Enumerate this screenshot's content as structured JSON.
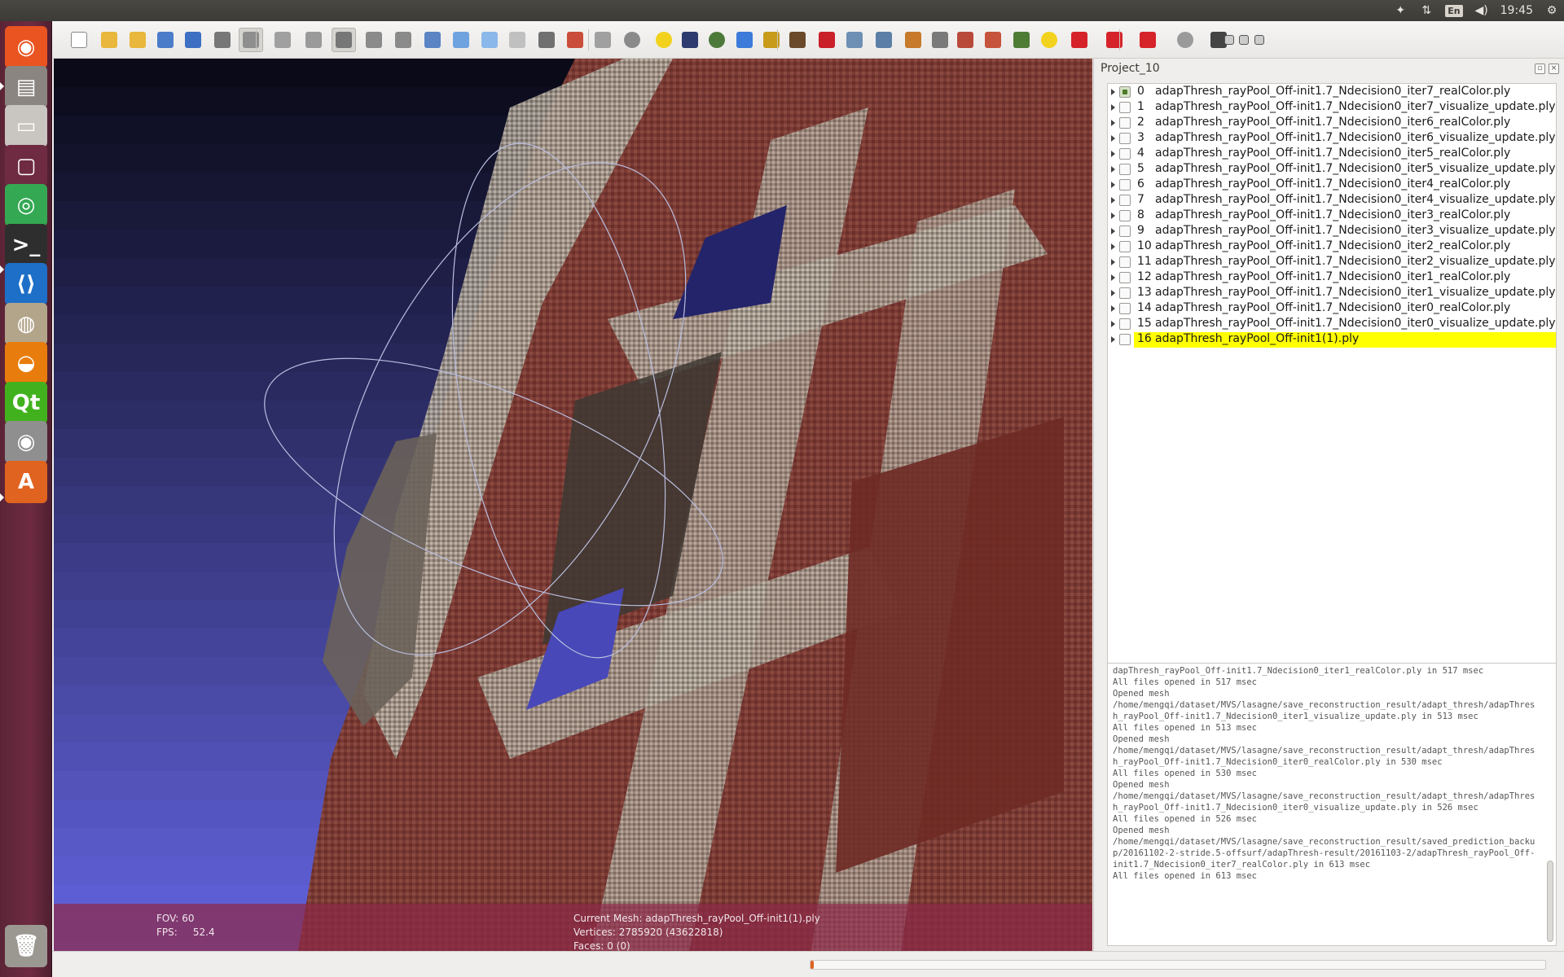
{
  "top_panel": {
    "lang": "En",
    "time": "19:45",
    "icons": [
      "dropbox-icon",
      "network-arrows-icon",
      "keyboard-lang-icon",
      "volume-icon",
      "settings-gear-icon"
    ]
  },
  "launcher": {
    "items": [
      {
        "name": "ubuntu-dash-icon",
        "glyph": "◉",
        "color": "#e95420"
      },
      {
        "name": "files-icon",
        "glyph": "▤",
        "color": "#8a8580"
      },
      {
        "name": "drive-icon",
        "glyph": "▭",
        "color": "#c9c5c0"
      },
      {
        "name": "window-icon",
        "glyph": "▢",
        "color": "#6e2b42"
      },
      {
        "name": "chrome-icon",
        "glyph": "◎",
        "color": "#34a853"
      },
      {
        "name": "terminal-icon",
        "glyph": ">_",
        "color": "#2e2e2e"
      },
      {
        "name": "vscode-icon",
        "glyph": "⟨⟩",
        "color": "#1e6fc7"
      },
      {
        "name": "screenshot-tool-icon",
        "glyph": "◍",
        "color": "#b3a58a"
      },
      {
        "name": "blender-icon",
        "glyph": "◒",
        "color": "#e87d0d"
      },
      {
        "name": "qt-creator-icon",
        "glyph": "Qt",
        "color": "#41b21e"
      },
      {
        "name": "eye-of-gnome-icon",
        "glyph": "◉",
        "color": "#8f8f8f"
      },
      {
        "name": "software-center-icon",
        "glyph": "A",
        "color": "#e0631f"
      },
      {
        "name": "trash-icon",
        "glyph": "🗑",
        "color": "#9b9892"
      }
    ]
  },
  "toolbar": {
    "buttons": [
      {
        "name": "new-project-icon",
        "color": "#ffffff"
      },
      {
        "name": "open-project-icon",
        "color": "#e8b73b"
      },
      {
        "name": "import-mesh-icon",
        "color": "#e8b73b"
      },
      {
        "name": "reload-icon",
        "color": "#4a7cc9"
      },
      {
        "name": "export-mesh-icon",
        "color": "#3d6fc2"
      },
      {
        "name": "snapshot-icon",
        "color": "#777777"
      },
      {
        "name": "layer-dialog-icon",
        "color": "#8e8e8e"
      },
      {
        "name": "global-settings-icon",
        "color": "#a0a0a0"
      },
      {
        "name": "render-bbox-icon",
        "color": "#9a9a9a"
      },
      {
        "name": "render-points-icon",
        "color": "#777777"
      },
      {
        "name": "render-wire-icon",
        "color": "#8a8a8a"
      },
      {
        "name": "render-hidden-lines-icon",
        "color": "#8a8a8a"
      },
      {
        "name": "render-flat-lines-icon",
        "color": "#5a84c4"
      },
      {
        "name": "render-flat-icon",
        "color": "#6fa3e0"
      },
      {
        "name": "render-smooth-icon",
        "color": "#8ab8ea"
      },
      {
        "name": "render-texture-icon",
        "color": "#c0c0c0"
      },
      {
        "name": "light-on-icon",
        "color": "#707070"
      },
      {
        "name": "backface-icon",
        "color": "#c94d3a"
      },
      {
        "name": "selection-faces-icon",
        "color": "#a0a0a0"
      },
      {
        "name": "trackball-icon",
        "color": "#8a8a8a"
      },
      {
        "name": "annotation-icon",
        "color": "#f2d21c"
      },
      {
        "name": "shader-icon",
        "color": "#2d3b6e"
      },
      {
        "name": "texture-sphere-icon",
        "color": "#4d7a3a"
      },
      {
        "name": "measure-axis-icon",
        "color": "#3c7bd9"
      },
      {
        "name": "paint-icon",
        "color": "#c89b1a"
      },
      {
        "name": "brush-icon",
        "color": "#6a4a2a"
      },
      {
        "name": "pdf-icon",
        "color": "#c9202a"
      },
      {
        "name": "pick-points-icon",
        "color": "#6d8fb3"
      },
      {
        "name": "align-icon",
        "color": "#5b7fa6"
      },
      {
        "name": "z-painting-icon",
        "color": "#c67a2a"
      },
      {
        "name": "select-vertices-icon",
        "color": "#7a7a7a"
      },
      {
        "name": "edit-faces-icon",
        "color": "#b94a3a"
      },
      {
        "name": "edit-quality-icon",
        "color": "#c6533b"
      },
      {
        "name": "raster-icon",
        "color": "#4f7c35"
      },
      {
        "name": "info-icon",
        "color": "#f2d21c"
      },
      {
        "name": "delete-vertices-icon",
        "color": "#d6232a"
      },
      {
        "name": "delete-faces-icon",
        "color": "#d6232a"
      },
      {
        "name": "delete-all-icon",
        "color": "#d6232a"
      },
      {
        "name": "search-icon",
        "color": "#9a9a9a"
      },
      {
        "name": "eye-icon",
        "color": "#444444"
      },
      {
        "name": "minimize-icon",
        "color": "#cccccc"
      },
      {
        "name": "restore-icon",
        "color": "#cccccc"
      },
      {
        "name": "close-icon",
        "color": "#cccccc"
      }
    ]
  },
  "viewport": {
    "fov_label": "FOV: 60",
    "fps_label": "FPS:     52.4",
    "current_mesh": "Current Mesh: adapThresh_rayPool_Off-init1(1).ply",
    "vertices": "Vertices: 2785920 (43622818)",
    "faces": "Faces: 0 (0)"
  },
  "project": {
    "title": "Project_10",
    "layers": [
      {
        "index": "0",
        "name": "adapThresh_rayPool_Off-init1.7_Ndecision0_iter7_realColor.ply",
        "visible": true
      },
      {
        "index": "1",
        "name": "adapThresh_rayPool_Off-init1.7_Ndecision0_iter7_visualize_update.ply",
        "visible": false
      },
      {
        "index": "2",
        "name": "adapThresh_rayPool_Off-init1.7_Ndecision0_iter6_realColor.ply",
        "visible": false
      },
      {
        "index": "3",
        "name": "adapThresh_rayPool_Off-init1.7_Ndecision0_iter6_visualize_update.ply",
        "visible": false
      },
      {
        "index": "4",
        "name": "adapThresh_rayPool_Off-init1.7_Ndecision0_iter5_realColor.ply",
        "visible": false
      },
      {
        "index": "5",
        "name": "adapThresh_rayPool_Off-init1.7_Ndecision0_iter5_visualize_update.ply",
        "visible": false
      },
      {
        "index": "6",
        "name": "adapThresh_rayPool_Off-init1.7_Ndecision0_iter4_realColor.ply",
        "visible": false
      },
      {
        "index": "7",
        "name": "adapThresh_rayPool_Off-init1.7_Ndecision0_iter4_visualize_update.ply",
        "visible": false
      },
      {
        "index": "8",
        "name": "adapThresh_rayPool_Off-init1.7_Ndecision0_iter3_realColor.ply",
        "visible": false
      },
      {
        "index": "9",
        "name": "adapThresh_rayPool_Off-init1.7_Ndecision0_iter3_visualize_update.ply",
        "visible": false
      },
      {
        "index": "10",
        "name": "adapThresh_rayPool_Off-init1.7_Ndecision0_iter2_realColor.ply",
        "visible": false
      },
      {
        "index": "11",
        "name": "adapThresh_rayPool_Off-init1.7_Ndecision0_iter2_visualize_update.ply",
        "visible": false
      },
      {
        "index": "12",
        "name": "adapThresh_rayPool_Off-init1.7_Ndecision0_iter1_realColor.ply",
        "visible": false
      },
      {
        "index": "13",
        "name": "adapThresh_rayPool_Off-init1.7_Ndecision0_iter1_visualize_update.ply",
        "visible": false
      },
      {
        "index": "14",
        "name": "adapThresh_rayPool_Off-init1.7_Ndecision0_iter0_realColor.ply",
        "visible": false
      },
      {
        "index": "15",
        "name": "adapThresh_rayPool_Off-init1.7_Ndecision0_iter0_visualize_update.ply",
        "visible": false
      },
      {
        "index": "16",
        "name": "adapThresh_rayPool_Off-init1(1).ply",
        "visible": false,
        "selected": true
      }
    ]
  },
  "log": {
    "text": "dapThresh_rayPool_Off-init1.7_Ndecision0_iter1_realColor.ply in 517 msec\nAll files opened in 517 msec\nOpened mesh\n/home/mengqi/dataset/MVS/lasagne/save_reconstruction_result/adapt_thresh/adapThresh_rayPool_Off-init1.7_Ndecision0_iter1_visualize_update.ply in 513 msec\nAll files opened in 513 msec\nOpened mesh\n/home/mengqi/dataset/MVS/lasagne/save_reconstruction_result/adapt_thresh/adapThresh_rayPool_Off-init1.7_Ndecision0_iter0_realColor.ply in 530 msec\nAll files opened in 530 msec\nOpened mesh\n/home/mengqi/dataset/MVS/lasagne/save_reconstruction_result/adapt_thresh/adapThresh_rayPool_Off-init1.7_Ndecision0_iter0_visualize_update.ply in 526 msec\nAll files opened in 526 msec\nOpened mesh\n/home/mengqi/dataset/MVS/lasagne/save_reconstruction_result/saved_prediction_backup/20161102-2-stride.5-offsurf/adapThresh-result/20161103-2/adapThresh_rayPool_Off-init1.7_Ndecision0_iter7_realColor.ply in 613 msec\nAll files opened in 613 msec"
  },
  "status": {
    "progress": 0.003
  }
}
